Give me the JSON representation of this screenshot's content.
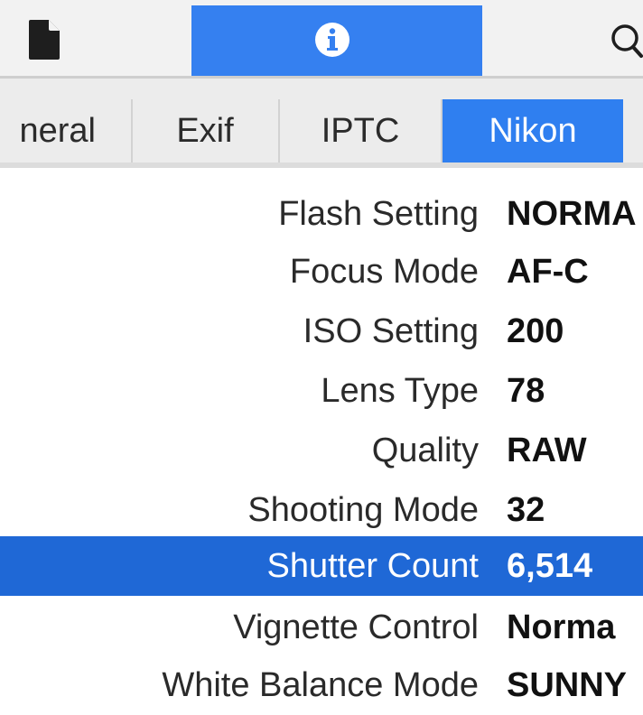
{
  "toolbar": {
    "buttons": [
      {
        "icon": "document-icon"
      },
      {
        "icon": "info-icon",
        "selected": true
      },
      {
        "icon": "search-icon"
      }
    ],
    "accent": "#3580f0"
  },
  "tabs": [
    {
      "label": "neral"
    },
    {
      "label": "Exif"
    },
    {
      "label": "IPTC"
    },
    {
      "label": "Nikon",
      "selected": true
    }
  ],
  "metadata": {
    "rows": [
      {
        "key": "Flash Setting",
        "value": "NORMA"
      },
      {
        "key": "Focus Mode",
        "value": "AF-C"
      },
      {
        "key": "ISO Setting",
        "value": "200"
      },
      {
        "key": "Lens Type",
        "value": "78"
      },
      {
        "key": "Quality",
        "value": "RAW"
      },
      {
        "key": "Shooting Mode",
        "value": "32"
      },
      {
        "key": "Shutter Count",
        "value": "6,514",
        "selected": true
      },
      {
        "key": "Vignette Control",
        "value": "Norma"
      },
      {
        "key": "White Balance Mode",
        "value": "SUNNY"
      }
    ],
    "selection_color": "#1f68d6"
  }
}
